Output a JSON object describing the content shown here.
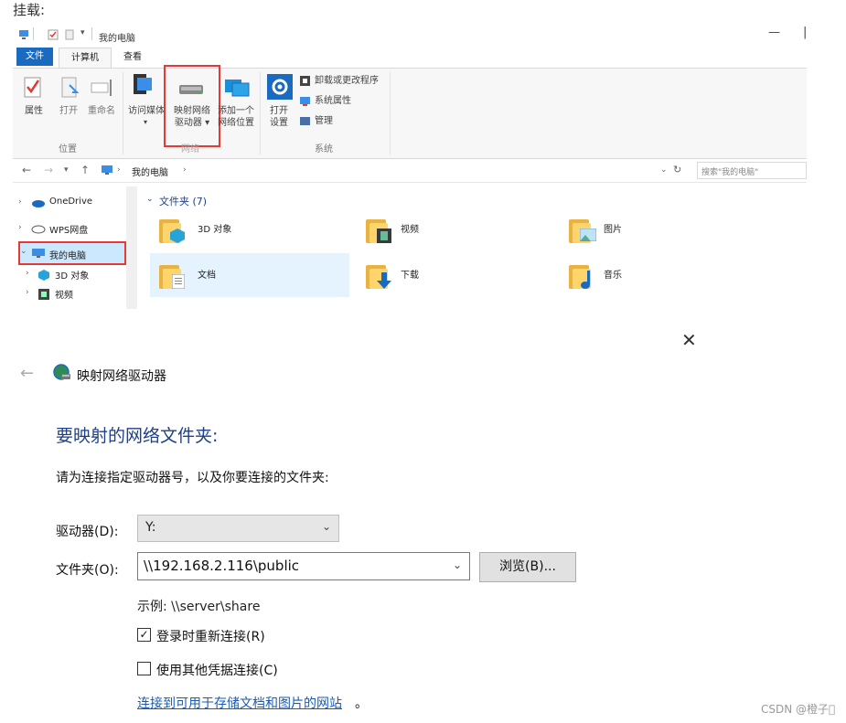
{
  "caption": "挂载:",
  "explorer": {
    "title": "我的电脑",
    "window_controls": {
      "minimize": "—",
      "maximize": "|"
    },
    "tabs": [
      "文件",
      "计算机",
      "查看"
    ],
    "ribbon": {
      "location_buttons": [
        "属性",
        "打开",
        "重命名"
      ],
      "access_media": "访问媒体",
      "map_drive": [
        "映射网络",
        "驱动器 ▾"
      ],
      "add_network_location": [
        "添加一个",
        "网络位置"
      ],
      "open_settings": [
        "打开",
        "设置"
      ],
      "system_items": [
        "卸载或更改程序",
        "系统属性",
        "管理"
      ],
      "groups": {
        "location": "位置",
        "network": "网络",
        "system": "系统"
      }
    },
    "address": {
      "path": "我的电脑",
      "search_placeholder": "搜索\"我的电脑\""
    },
    "nav": [
      "OneDrive",
      "WPS网盘",
      "我的电脑",
      "3D 对象",
      "视频"
    ],
    "section_header": "文件夹 (7)",
    "folders": [
      "3D 对象",
      "视频",
      "图片",
      "文档",
      "下载",
      "音乐"
    ]
  },
  "dialog": {
    "close_glyph": "✕",
    "back_glyph": "←",
    "title": "映射网络驱动器",
    "heading": "要映射的网络文件夹:",
    "instruction": "请为连接指定驱动器号，以及你要连接的文件夹:",
    "drive_label": "驱动器(D):",
    "drive_value": "Y:",
    "folder_label": "文件夹(O):",
    "folder_value": "\\\\192.168.2.116\\public",
    "browse_label": "浏览(B)...",
    "example": "示例: \\\\server\\share",
    "reconnect_label": "登录时重新连接(R)",
    "reconnect_checked": true,
    "other_creds_label": "使用其他凭据连接(C)",
    "other_creds_checked": false,
    "link": "连接到可用于存储文档和图片的网站",
    "link_suffix": "。"
  },
  "watermark": "CSDN @橙子\u0000"
}
